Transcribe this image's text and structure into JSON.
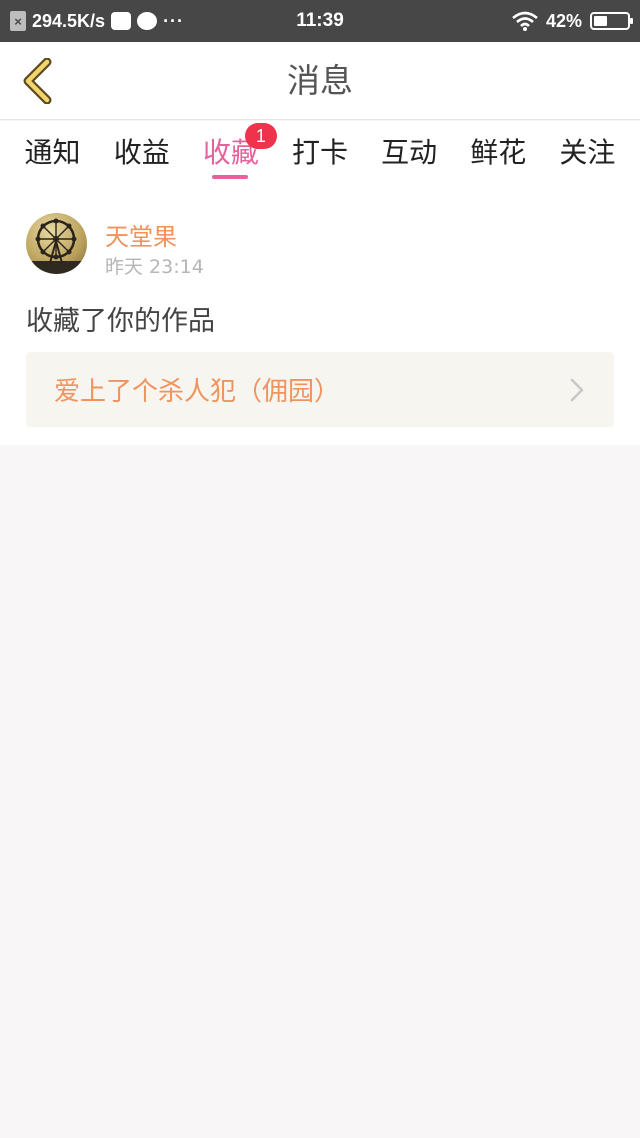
{
  "status_bar": {
    "network_speed": "294.5K/s",
    "more": "···",
    "time": "11:39",
    "battery_percent": "42%",
    "battery_level": 0.42
  },
  "header": {
    "title": "消息"
  },
  "tabs": [
    {
      "label": "通知"
    },
    {
      "label": "收益"
    },
    {
      "label": "收藏",
      "badge": "1"
    },
    {
      "label": "打卡"
    },
    {
      "label": "互动"
    },
    {
      "label": "鲜花"
    },
    {
      "label": "关注"
    }
  ],
  "message": {
    "sender": "天堂果",
    "time": "昨天 23:14",
    "text": "收藏了你的作品",
    "work_title": "爱上了个杀人犯（佣园）"
  },
  "colors": {
    "accent": "#e5629c",
    "orange": "#f0935c",
    "badge": "#f0334c",
    "status_bar": "#474747",
    "background": "#f8f6f6"
  }
}
